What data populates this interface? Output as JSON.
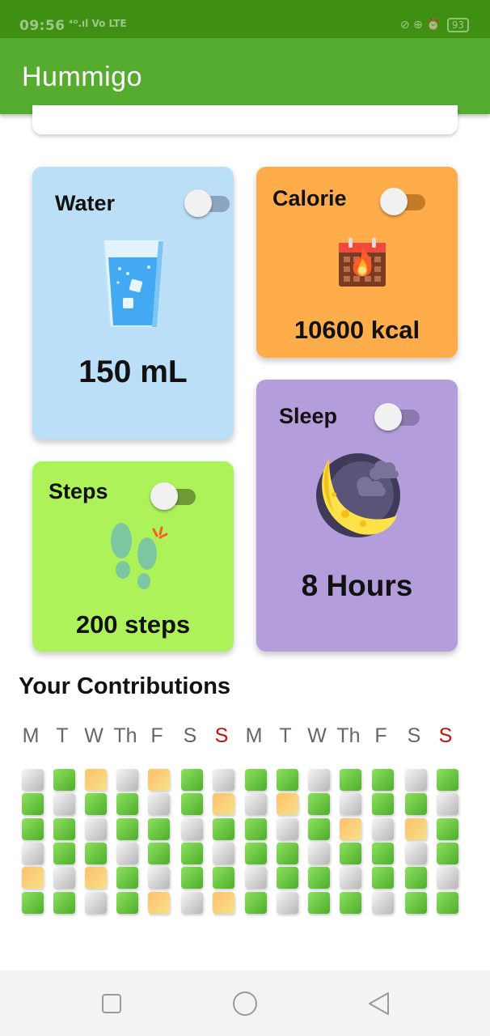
{
  "status_bar": {
    "time": "09:56",
    "signal": "⁴ᴳ.ıl",
    "volte": "Vo LTE",
    "icons": "⊘ ⊕ ⏰",
    "battery": "93"
  },
  "app_bar": {
    "title": "Hummigo"
  },
  "cards": {
    "water": {
      "title": "Water",
      "value": "150 mL",
      "toggle_on": false,
      "icon": "water-glass-icon",
      "color": "#bcdff8"
    },
    "calorie": {
      "title": "Calorie",
      "value": "10600 kcal",
      "toggle_on": false,
      "icon": "calendar-fire-icon",
      "color": "#ffac4a"
    },
    "sleep": {
      "title": "Sleep",
      "value": "8 Hours",
      "toggle_on": false,
      "icon": "moon-icon",
      "color": "#b39ddb"
    },
    "steps": {
      "title": "Steps",
      "value": "200 steps",
      "toggle_on": false,
      "icon": "footprints-icon",
      "color": "#aef25a"
    }
  },
  "contributions": {
    "title": "Your Contributions",
    "days": [
      "M",
      "T",
      "W",
      "Th",
      "F",
      "S",
      "S",
      "M",
      "T",
      "W",
      "Th",
      "F",
      "S",
      "S"
    ],
    "sunday_color": "#c41010",
    "grid": [
      [
        "g",
        "G",
        "o",
        "g",
        "o",
        "G",
        "g",
        "G",
        "G",
        "g",
        "G",
        "G",
        "g",
        "G"
      ],
      [
        "G",
        "g",
        "G",
        "G",
        "g",
        "G",
        "o",
        "g",
        "o",
        "G",
        "g",
        "G",
        "G",
        "g"
      ],
      [
        "G",
        "G",
        "g",
        "G",
        "G",
        "g",
        "G",
        "G",
        "g",
        "G",
        "o",
        "g",
        "o",
        "G"
      ],
      [
        "g",
        "G",
        "G",
        "g",
        "G",
        "G",
        "g",
        "G",
        "G",
        "g",
        "G",
        "G",
        "g",
        "G"
      ],
      [
        "o",
        "g",
        "o",
        "G",
        "g",
        "G",
        "G",
        "g",
        "G",
        "G",
        "g",
        "G",
        "G",
        "g"
      ],
      [
        "G",
        "G",
        "g",
        "G",
        "o",
        "g",
        "o",
        "G",
        "g",
        "G",
        "G",
        "g",
        "G",
        "G"
      ]
    ]
  },
  "nav": {
    "recent": "square-icon",
    "home": "circle-icon",
    "back": "triangle-back-icon"
  }
}
